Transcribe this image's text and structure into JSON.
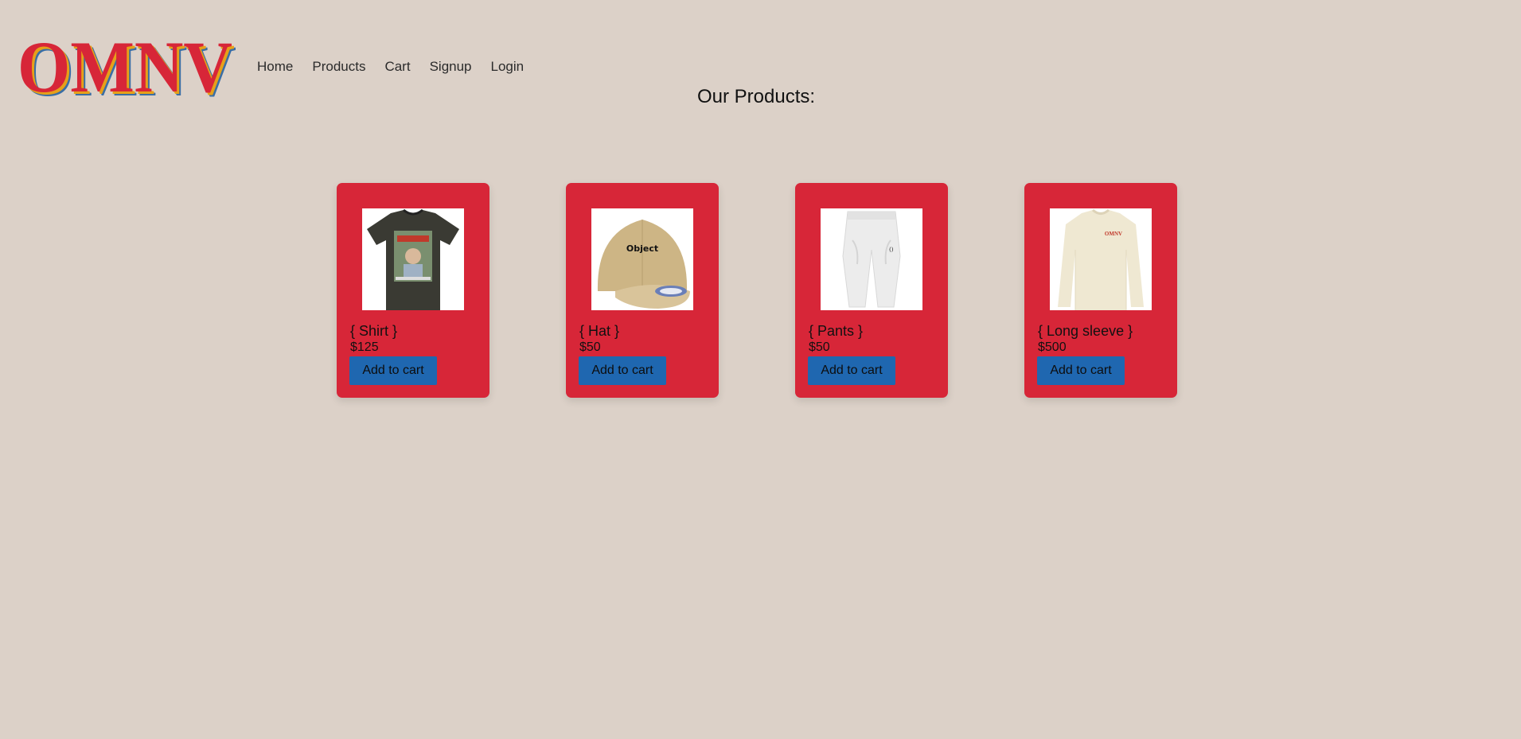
{
  "brand": {
    "logo_text": "OMNV",
    "colors": {
      "logo_main": "#d72638",
      "logo_shadow_1": "#e6a019",
      "logo_shadow_2": "#3a6ea5"
    }
  },
  "nav": {
    "items": [
      {
        "label": "Home"
      },
      {
        "label": "Products"
      },
      {
        "label": "Cart"
      },
      {
        "label": "Signup"
      },
      {
        "label": "Login"
      }
    ]
  },
  "main": {
    "title": "Our Products:"
  },
  "products": [
    {
      "name": "{ Shirt }",
      "price": "$125",
      "button_label": "Add to cart",
      "image": "shirt-image"
    },
    {
      "name": "{ Hat }",
      "price": "$50",
      "button_label": "Add to cart",
      "image": "hat-image",
      "image_text": "Object"
    },
    {
      "name": "{ Pants }",
      "price": "$50",
      "button_label": "Add to cart",
      "image": "pants-image"
    },
    {
      "name": "{ Long sleeve }",
      "price": "$500",
      "button_label": "Add to cart",
      "image": "long-sleeve-image",
      "image_text": "OMNV"
    }
  ],
  "theme": {
    "background": "#dcd1c8",
    "card_color": "#d72638",
    "button_color": "#1f67b0"
  }
}
